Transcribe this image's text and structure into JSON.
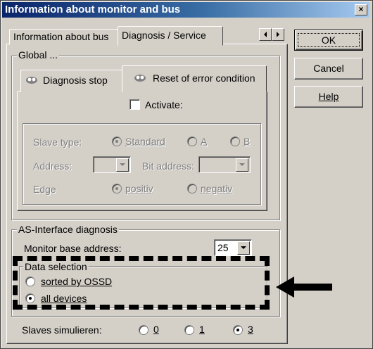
{
  "window": {
    "title": "Information about monitor and bus",
    "close_glyph": "×"
  },
  "buttons": {
    "ok": "OK",
    "cancel": "Cancel",
    "help": "Help"
  },
  "tabs": {
    "info_bus": "Information about bus",
    "diag_service": "Diagnosis / Service"
  },
  "global": {
    "legend": "Global ...",
    "subtab_stop": "Diagnosis stop",
    "subtab_reset": "Reset of error condition",
    "activate": "Activate:",
    "activate_checked": false,
    "slave_type_label": "Slave type:",
    "slave_type_options": [
      "Standard",
      "A",
      "B"
    ],
    "slave_type_selected": "Standard",
    "address_label": "Address:",
    "address_value": "",
    "bit_address_label": "Bit address:",
    "bit_address_value": "",
    "edge_label": "Edge",
    "edge_options": [
      "positiv",
      "negativ"
    ],
    "edge_selected": "positiv"
  },
  "asi": {
    "legend": "AS-Interface diagnosis",
    "monitor_base_label": "Monitor base address:",
    "monitor_base_value": "25",
    "data_selection": {
      "legend": "Data selection",
      "options": [
        "sorted by OSSD",
        "all devices"
      ],
      "selected": "all devices"
    }
  },
  "slaves": {
    "label": "Slaves simulieren:",
    "options": [
      "0",
      "1",
      "3"
    ],
    "selected": "3"
  },
  "icons": {
    "subtab_icon": "eye-icon",
    "annotation": "arrow-left-icon",
    "scroll_left": "triangle-left-icon",
    "scroll_right": "triangle-right-icon"
  }
}
